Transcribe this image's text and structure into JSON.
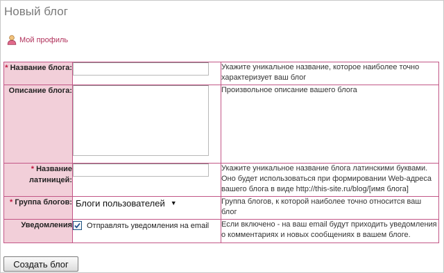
{
  "page": {
    "title": "Новый блог"
  },
  "profile": {
    "label": "Мой профиль",
    "icon": "user-icon"
  },
  "form": {
    "required_mark": "*",
    "name": {
      "label": "Название блога:",
      "value": "",
      "hint": "Укажите уникальное название, которое наиболее точно характеризует ваш блог"
    },
    "description": {
      "label": "Описание блога:",
      "value": "",
      "hint": "Произвольное описание вашего блога"
    },
    "latin_name": {
      "label": "Название латиницей:",
      "value": "",
      "hint": "Укажите уникальное название блога латинскими буквами. Оно будет использоваться при формировании Web-адреса вашего блога в виде http://this-site.ru/blog/[имя блога]"
    },
    "group": {
      "label": "Группа блогов:",
      "selected": "Блоги пользователей",
      "hint": "Группа блогов, к которой наиболее точно относится ваш блог"
    },
    "notifications": {
      "label": "Уведомления",
      "checkbox_label": "Отправлять уведомления на email",
      "checked": true,
      "hint": "Если включено - на ваш email будут приходить уведомления о комментариях и новых сообщениях в вашем блоге."
    }
  },
  "submit": {
    "label": "Создать блог"
  },
  "colors": {
    "label_bg": "#f2cfd9",
    "border": "#c25586",
    "required": "#c0143c",
    "link": "#b0305a"
  }
}
